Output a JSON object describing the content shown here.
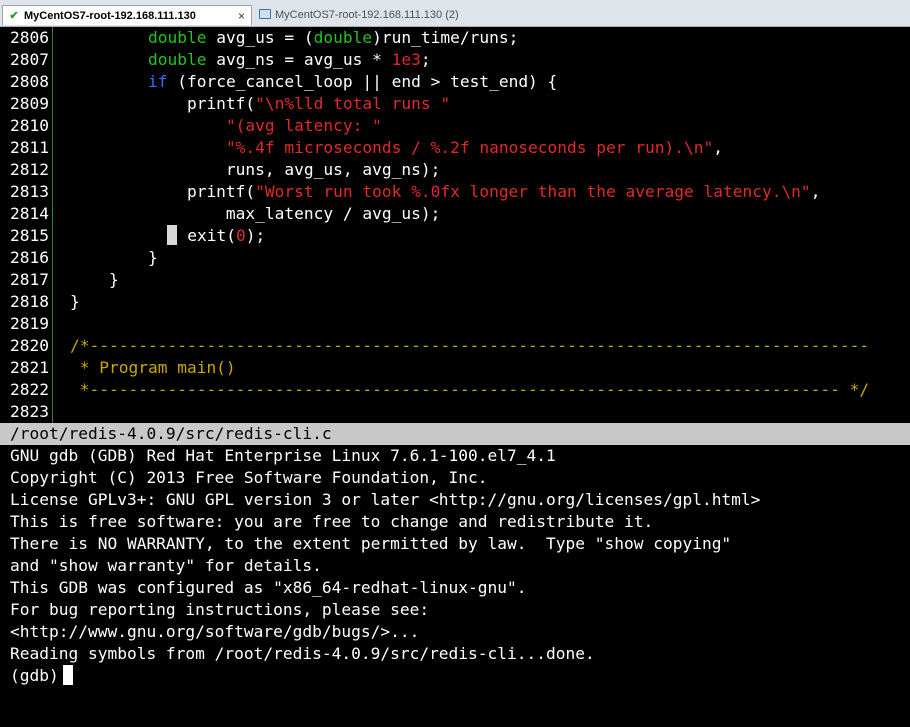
{
  "tabs": [
    {
      "label": "MyCentOS7-root-192.168.111.130",
      "icon": "check-icon",
      "close": "×"
    },
    {
      "label": "MyCentOS7-root-192.168.111.130 (2)",
      "icon": "monitor-icon"
    }
  ],
  "colors": {
    "keyword_green": "#21c321",
    "keyword_blue": "#3a6cff",
    "string_red": "#e02a2a",
    "comment_yellow": "#c8a800",
    "status_bar": "#c8c8c8"
  },
  "editor": {
    "lines": [
      {
        "n": "2806",
        "seg": [
          [
            "p",
            "        "
          ],
          [
            "g",
            "double"
          ],
          [
            "p",
            " avg_us = ("
          ],
          [
            "g",
            "double"
          ],
          [
            "p",
            ")run_time/runs;"
          ]
        ]
      },
      {
        "n": "2807",
        "seg": [
          [
            "p",
            "        "
          ],
          [
            "g",
            "double"
          ],
          [
            "p",
            " avg_ns = avg_us * "
          ],
          [
            "r",
            "1e3"
          ],
          [
            "p",
            ";"
          ]
        ]
      },
      {
        "n": "2808",
        "seg": [
          [
            "p",
            "        "
          ],
          [
            "b",
            "if"
          ],
          [
            "p",
            " (force_cancel_loop || end > test_end) {"
          ]
        ]
      },
      {
        "n": "2809",
        "seg": [
          [
            "p",
            "            printf("
          ],
          [
            "r",
            "\"\\n%lld total runs \""
          ]
        ]
      },
      {
        "n": "2810",
        "seg": [
          [
            "p",
            "                "
          ],
          [
            "r",
            "\"(avg latency: \""
          ]
        ]
      },
      {
        "n": "2811",
        "seg": [
          [
            "p",
            "                "
          ],
          [
            "r",
            "\"%.4f microseconds / %.2f nanoseconds per run).\\n\""
          ],
          [
            "p",
            ","
          ]
        ]
      },
      {
        "n": "2812",
        "seg": [
          [
            "p",
            "                runs, avg_us, avg_ns);"
          ]
        ]
      },
      {
        "n": "2813",
        "seg": [
          [
            "p",
            "            printf("
          ],
          [
            "r",
            "\"Worst run took %.0fx longer than the average latency.\\n\""
          ],
          [
            "p",
            ","
          ]
        ]
      },
      {
        "n": "2814",
        "seg": [
          [
            "p",
            "                max_latency / avg_us);"
          ]
        ]
      },
      {
        "n": "2815",
        "seg": [
          [
            "p",
            "          "
          ],
          [
            "cur",
            ""
          ],
          [
            "p",
            " exit("
          ],
          [
            "r",
            "0"
          ],
          [
            "p",
            ");"
          ]
        ]
      },
      {
        "n": "2816",
        "seg": [
          [
            "p",
            "        }"
          ]
        ]
      },
      {
        "n": "2817",
        "seg": [
          [
            "p",
            "    }"
          ]
        ]
      },
      {
        "n": "2818",
        "seg": [
          [
            "p",
            "}"
          ]
        ]
      },
      {
        "n": "2819",
        "seg": [
          [
            "p",
            ""
          ]
        ]
      },
      {
        "n": "2820",
        "seg": [
          [
            "y",
            "/*--------------------------------------------------------------------------------"
          ]
        ]
      },
      {
        "n": "2821",
        "seg": [
          [
            "y",
            " * Program main()"
          ]
        ]
      },
      {
        "n": "2822",
        "seg": [
          [
            "y",
            " *----------------------------------------------------------------------------- */"
          ]
        ]
      },
      {
        "n": "2823",
        "seg": [
          [
            "p",
            ""
          ]
        ]
      }
    ]
  },
  "status_bar": "/root/redis-4.0.9/src/redis-cli.c",
  "gdb_output": [
    "GNU gdb (GDB) Red Hat Enterprise Linux 7.6.1-100.el7_4.1",
    "Copyright (C) 2013 Free Software Foundation, Inc.",
    "License GPLv3+: GNU GPL version 3 or later <http://gnu.org/licenses/gpl.html>",
    "This is free software: you are free to change and redistribute it.",
    "There is NO WARRANTY, to the extent permitted by law.  Type \"show copying\"",
    "and \"show warranty\" for details.",
    "This GDB was configured as \"x86_64-redhat-linux-gnu\".",
    "For bug reporting instructions, please see:",
    "<http://www.gnu.org/software/gdb/bugs/>...",
    "Reading symbols from /root/redis-4.0.9/src/redis-cli...done."
  ],
  "prompt": "(gdb)"
}
